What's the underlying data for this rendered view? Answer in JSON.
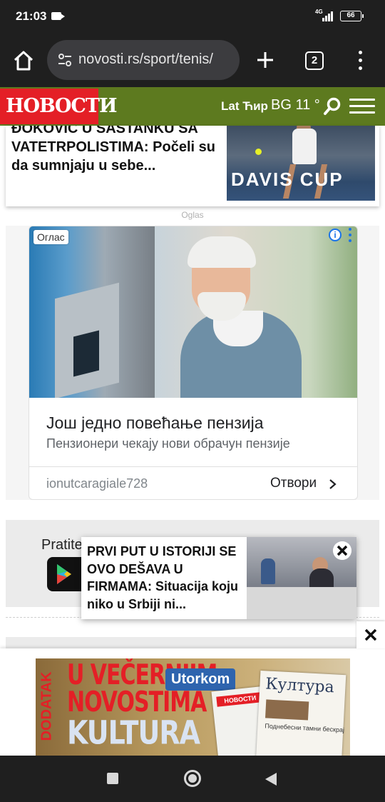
{
  "status_bar": {
    "time": "21:03",
    "network": "4G",
    "battery": "66"
  },
  "browser": {
    "url": "novosti.rs/sport/tenis/",
    "tab_count": "2"
  },
  "site_header": {
    "logo": "НОВОСТИ",
    "lang_switch": "Lat Ћир",
    "weather": "BG 11 °"
  },
  "article_card": {
    "title": "ĐOKOVIĆ U SASTANKU SA VATETRPOLISTIMA: Počeli su da sumnjaju u sebe...",
    "image_text": "DAVIS CUP"
  },
  "ad_label": "Oglas",
  "ad": {
    "tag": "Оглас",
    "headline": "Још једно повећање пензија",
    "subline": "Пензионери чекају нови обрачун пензије",
    "advertiser": "ionutcaragiale728",
    "open_label": "Отвори"
  },
  "follow": {
    "text": "Pratite"
  },
  "popup": {
    "title": "PRVI PUT U ISTORIJI SE OVO DEŠAVA U FIRMAMA: Situacija koju niko u Srbiji ni..."
  },
  "bottom_banner": {
    "line1": "U VEČERNJIM",
    "line2": "NOVOSTIMA",
    "line3": "KULTURA",
    "side": "DODATAK",
    "badge": "Utorkom",
    "paper_header": "НОВОСТИ",
    "paper_title": "Култура",
    "paper_subtitle": "Поднебесни тамни бескрај"
  },
  "colors": {
    "site_green": "#5d7a1f",
    "logo_red": "#e41f26",
    "browser_dark": "#1f1f1f",
    "ad_blue": "#1a73e8"
  }
}
